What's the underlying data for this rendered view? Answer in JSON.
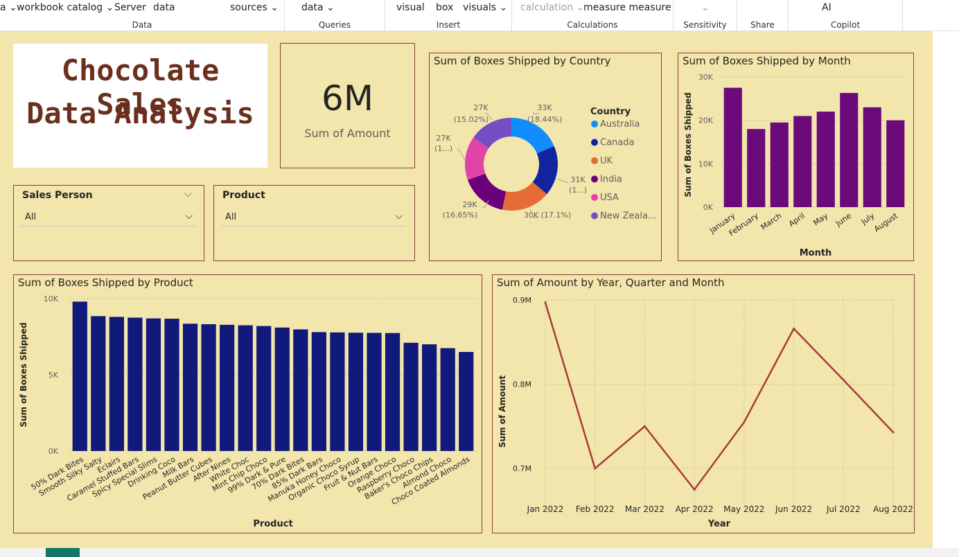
{
  "ribbon": {
    "groups": [
      {
        "label": "Data",
        "items": [
          {
            "text": "a",
            "chev": true,
            "x": 0
          },
          {
            "text": "workbook catalog",
            "chev": true,
            "x": 24
          },
          {
            "text": "Server",
            "chev": false,
            "x": 165
          },
          {
            "text": "data",
            "chev": false,
            "x": 221
          },
          {
            "text": "sources",
            "chev": true,
            "x": 332
          }
        ]
      },
      {
        "label": "Queries",
        "items": [
          {
            "text": "data",
            "chev": true,
            "x": 24
          }
        ]
      },
      {
        "label": "Insert",
        "items": [
          {
            "text": "visual",
            "chev": false,
            "x": 16
          },
          {
            "text": "box",
            "chev": false,
            "x": 73
          },
          {
            "text": "visuals",
            "chev": true,
            "x": 112
          }
        ]
      },
      {
        "label": "Calculations",
        "items": [
          {
            "text": "calculation",
            "chev": true,
            "x": 12,
            "disabled": true
          },
          {
            "text": "measure measure",
            "chev": false,
            "x": 103
          }
        ]
      },
      {
        "label": "Sensitivity",
        "items": [
          {
            "text": "",
            "chev": true,
            "x": 40,
            "disabled": true
          }
        ]
      },
      {
        "label": "Share",
        "items": []
      },
      {
        "label": "Copilot",
        "items": [
          {
            "text": "AI",
            "chev": false,
            "x": 48
          }
        ]
      }
    ]
  },
  "title_card": {
    "line1": "Chocolate Sales",
    "line2": "Data Analysis"
  },
  "kpi": {
    "value": "6M",
    "label": "Sum of Amount"
  },
  "slicers": [
    {
      "title": "Sales Person",
      "value": "All"
    },
    {
      "title": "Product",
      "value": "All"
    }
  ],
  "colors": {
    "canvas": "#f3e6ad",
    "panel_border": "#8b3a3a",
    "bar_product": "#11197a",
    "bar_month": "#6a0a7b",
    "line": "#a83a3a",
    "title_text": "#6b2f1e"
  },
  "chart_data": [
    {
      "type": "pie",
      "title": "Sum of Boxes Shipped by Country",
      "legend_title": "Country",
      "legend_position": "right",
      "categories": [
        "Australia",
        "Canada",
        "UK",
        "India",
        "USA",
        "New Zeala..."
      ],
      "values": [
        33,
        31,
        30,
        29,
        27,
        27
      ],
      "data_labels": [
        "33K (18.44%)",
        "31K (1...)",
        "30K (17.1%)",
        "29K (16.65%)",
        "27K (1...)",
        "27K (15.02%)"
      ],
      "colors": [
        "#118dff",
        "#12239e",
        "#e66c37",
        "#6b007b",
        "#e044a7",
        "#744ec2"
      ]
    },
    {
      "type": "bar",
      "title": "Sum of Boxes Shipped by Month",
      "xlabel": "Month",
      "ylabel": "Sum of Boxes Shipped",
      "categories": [
        "January",
        "February",
        "March",
        "April",
        "May",
        "June",
        "July",
        "August"
      ],
      "values": [
        27500,
        18000,
        19500,
        21000,
        22000,
        26300,
        23000,
        20000
      ],
      "ylim": [
        0,
        30000
      ],
      "yticks": [
        "0K",
        "10K",
        "20K",
        "30K"
      ]
    },
    {
      "type": "bar",
      "title": "Sum of Boxes Shipped by Product",
      "xlabel": "Product",
      "ylabel": "Sum of Boxes Shipped",
      "categories": [
        "50% Dark Bites",
        "Smooth Silky Salty",
        "Eclairs",
        "Caramel Stuffed Bars",
        "Spicy Special Slims",
        "Drinking Coco",
        "Milk Bars",
        "Peanut Butter Cubes",
        "After Nines",
        "White Choc",
        "Mint Chip Choco",
        "99% Dark & Pure",
        "70% Dark Bites",
        "85% Dark Bars",
        "Manuka Honey Choco",
        "Organic Choco Syrup",
        "Fruit & Nut Bars",
        "Orange Choco",
        "Raspberry Choco",
        "Baker's Choco Chips",
        "Almond Choco",
        "Choco Coated Almonds"
      ],
      "values": [
        9800,
        8850,
        8800,
        8750,
        8700,
        8680,
        8350,
        8320,
        8280,
        8250,
        8200,
        8100,
        7980,
        7800,
        7780,
        7760,
        7750,
        7740,
        7100,
        7000,
        6750,
        6500
      ],
      "ylim": [
        0,
        10000
      ],
      "yticks": [
        "0K",
        "5K",
        "10K"
      ]
    },
    {
      "type": "line",
      "title": "Sum of Amount by Year, Quarter and Month",
      "xlabel": "Year",
      "ylabel": "Sum of Amount",
      "categories": [
        "Jan 2022",
        "Feb 2022",
        "Mar 2022",
        "Apr 2022",
        "May 2022",
        "Jun 2022",
        "Jul 2022",
        "Aug 2022"
      ],
      "values": [
        0.897,
        0.7,
        0.75,
        0.675,
        0.755,
        0.866,
        0.805,
        0.743
      ],
      "ylim": [
        0.65,
        0.9
      ],
      "yticks": [
        "0.7M",
        "0.8M",
        "0.9M"
      ]
    }
  ]
}
